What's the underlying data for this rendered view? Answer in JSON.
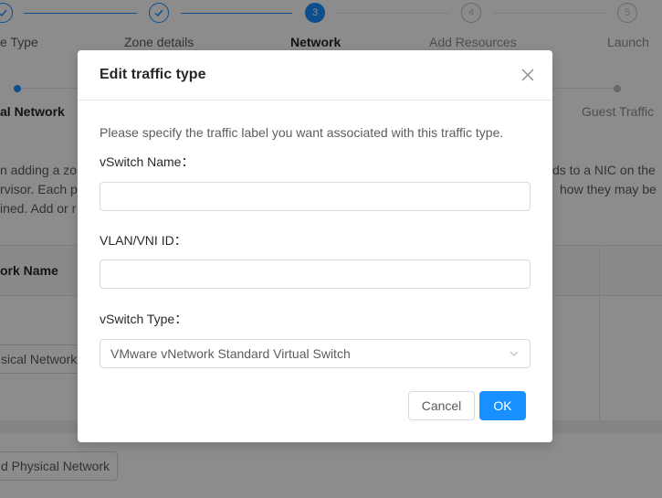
{
  "steps": [
    {
      "title": "e Type",
      "status": "done"
    },
    {
      "title": "Zone details",
      "status": "done"
    },
    {
      "title": "Network",
      "number": "3",
      "status": "active"
    },
    {
      "title": "Add Resources",
      "number": "4",
      "status": "todo"
    },
    {
      "title": "Launch",
      "number": "5",
      "status": "todo"
    }
  ],
  "substeps": {
    "first": "al Network",
    "last": "Guest Traffic"
  },
  "description": {
    "line1_left": "n adding a zo",
    "line1_right": "ds to a NIC on the",
    "line2_left": "rvisor. Each ph",
    "line2_right": "how they may be",
    "line3_left": "ined. Add or r"
  },
  "table": {
    "column_header": "ork Name",
    "row_button": "sical Network"
  },
  "add_physical_network_label": "d Physical Network",
  "modal": {
    "title": "Edit traffic type",
    "hint": "Please specify the traffic label you want associated with this traffic type.",
    "vswitch_name_label": "vSwitch Name：",
    "vswitch_name_value": "",
    "vlan_label": "VLAN/VNI ID：",
    "vlan_value": "",
    "vswitch_type_label": "vSwitch Type：",
    "vswitch_type_value": "VMware vNetwork Standard Virtual Switch",
    "cancel_label": "Cancel",
    "ok_label": "OK"
  },
  "colors": {
    "primary": "#1890ff",
    "mask": "rgba(0,0,0,0.45)"
  },
  "icons": {
    "check": "check-icon",
    "close": "close-icon",
    "dropdown": "chevron-down-icon"
  }
}
